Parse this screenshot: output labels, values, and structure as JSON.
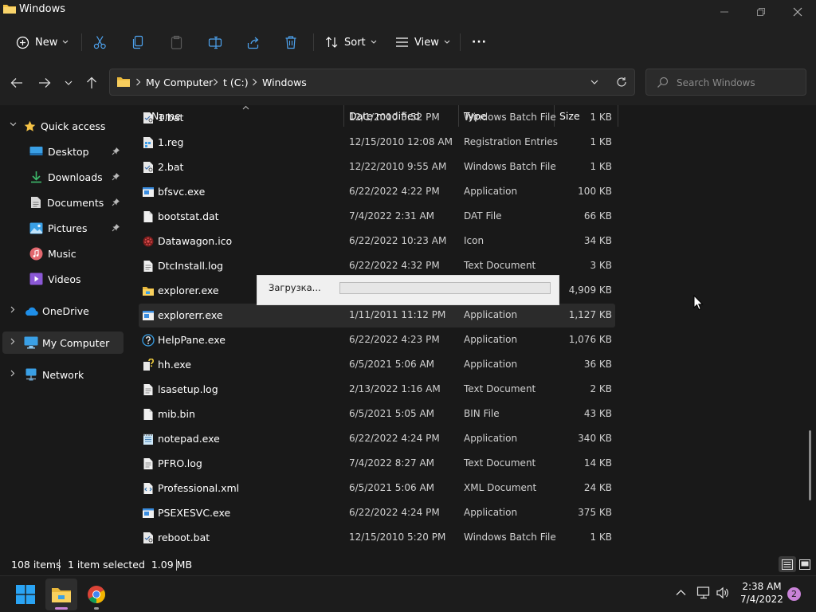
{
  "window": {
    "title": "Windows"
  },
  "toolbar": {
    "new_label": "New",
    "sort_label": "Sort",
    "view_label": "View",
    "more_label": "···"
  },
  "address": {
    "crumbs": [
      "My Computer",
      "t (C:)",
      "Windows"
    ],
    "search_placeholder": "Search Windows"
  },
  "nav": {
    "items": [
      {
        "label": "Quick access",
        "icon": "star-icon"
      },
      {
        "label": "Desktop",
        "icon": "desktop-icon",
        "pinned": true
      },
      {
        "label": "Downloads",
        "icon": "download-icon",
        "pinned": true
      },
      {
        "label": "Documents",
        "icon": "document-icon",
        "pinned": true
      },
      {
        "label": "Pictures",
        "icon": "picture-icon",
        "pinned": true
      },
      {
        "label": "Music",
        "icon": "music-icon"
      },
      {
        "label": "Videos",
        "icon": "video-icon"
      },
      {
        "label": "OneDrive",
        "icon": "cloud-icon"
      },
      {
        "label": "My Computer",
        "icon": "computer-icon",
        "selected": true
      },
      {
        "label": "Network",
        "icon": "network-icon"
      }
    ]
  },
  "columns": {
    "name": "Name",
    "date": "Date modified",
    "type": "Type",
    "size": "Size"
  },
  "files": [
    {
      "name": "1.bat",
      "date": "12/1/2010 3:52 PM",
      "type": "Windows Batch File",
      "size": "1 KB",
      "icon": "batch-file-icon"
    },
    {
      "name": "1.reg",
      "date": "12/15/2010 12:08 AM",
      "type": "Registration Entries",
      "size": "1 KB",
      "icon": "registry-file-icon"
    },
    {
      "name": "2.bat",
      "date": "12/22/2010 9:55 AM",
      "type": "Windows Batch File",
      "size": "1 KB",
      "icon": "batch-file-icon"
    },
    {
      "name": "bfsvc.exe",
      "date": "6/22/2022 4:22 PM",
      "type": "Application",
      "size": "100 KB",
      "icon": "application-icon"
    },
    {
      "name": "bootstat.dat",
      "date": "7/4/2022 2:31 AM",
      "type": "DAT File",
      "size": "66 KB",
      "icon": "file-icon"
    },
    {
      "name": "Datawagon.ico",
      "date": "6/22/2022 10:23 AM",
      "type": "Icon",
      "size": "34 KB",
      "icon": "ico-file-icon"
    },
    {
      "name": "DtcInstall.log",
      "date": "6/22/2022 4:32 PM",
      "type": "Text Document",
      "size": "3 KB",
      "icon": "text-file-icon"
    },
    {
      "name": "explorer.exe",
      "date": "",
      "type": "",
      "size": "4,909 KB",
      "icon": "folder-app-icon"
    },
    {
      "name": "explorerr.exe",
      "date": "1/11/2011 11:12 PM",
      "type": "Application",
      "size": "1,127 KB",
      "icon": "application-icon",
      "selected": true
    },
    {
      "name": "HelpPane.exe",
      "date": "6/22/2022 4:23 PM",
      "type": "Application",
      "size": "1,076 KB",
      "icon": "help-icon"
    },
    {
      "name": "hh.exe",
      "date": "6/5/2021 5:06 AM",
      "type": "Application",
      "size": "36 KB",
      "icon": "help-app-icon"
    },
    {
      "name": "lsasetup.log",
      "date": "2/13/2022 1:16 AM",
      "type": "Text Document",
      "size": "2 KB",
      "icon": "text-file-icon"
    },
    {
      "name": "mib.bin",
      "date": "6/5/2021 5:05 AM",
      "type": "BIN File",
      "size": "43 KB",
      "icon": "file-icon"
    },
    {
      "name": "notepad.exe",
      "date": "6/22/2022 4:24 PM",
      "type": "Application",
      "size": "340 KB",
      "icon": "notepad-icon"
    },
    {
      "name": "PFRO.log",
      "date": "7/4/2022 8:27 AM",
      "type": "Text Document",
      "size": "14 KB",
      "icon": "text-file-icon"
    },
    {
      "name": "Professional.xml",
      "date": "6/5/2021 5:06 AM",
      "type": "XML Document",
      "size": "24 KB",
      "icon": "xml-file-icon"
    },
    {
      "name": "PSEXESVC.exe",
      "date": "6/22/2022 4:24 PM",
      "type": "Application",
      "size": "375 KB",
      "icon": "application-icon"
    },
    {
      "name": "reboot.bat",
      "date": "12/15/2010 5:20 PM",
      "type": "Windows Batch File",
      "size": "1 KB",
      "icon": "batch-file-icon"
    }
  ],
  "loading": {
    "label": "Загрузка...",
    "progress": 0
  },
  "status": {
    "items_count": "108 items",
    "selection": "1 item selected  1.09 MB"
  },
  "taskbar": {
    "time": "2:38 AM",
    "date": "7/4/2022",
    "notifications": "2"
  },
  "colors": {
    "accent": "#0078d4",
    "folder": "#f4c245",
    "progress": "#06b025"
  }
}
